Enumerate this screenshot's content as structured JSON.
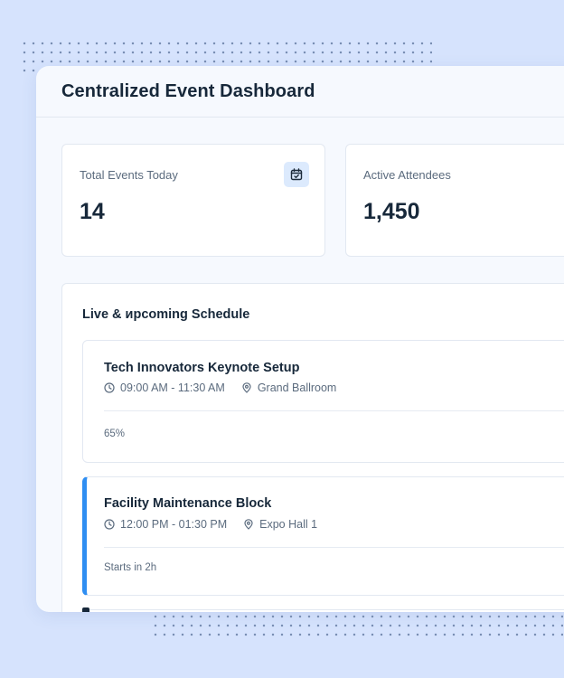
{
  "dashboard": {
    "title": "Centralized Event Dashboard"
  },
  "stats": [
    {
      "label": "Total Events Today",
      "value": "14",
      "icon": "calendar-check-icon"
    },
    {
      "label": "Active Attendees",
      "value": "1,450"
    }
  ],
  "schedule": {
    "title": "Live & иpcoming Schedule",
    "events": [
      {
        "title": "Tech Innovators Keynote Setup",
        "time": "09:00 AM - 11:30 AM",
        "location": "Grand Ballroom",
        "footer": "65%"
      },
      {
        "title": "Facility Maintenance Block",
        "time": "12:00 PM - 01:30 PM",
        "location": "Expo Hall 1",
        "footer": "Starts in 2h",
        "accent_color": "#2f8ef2"
      }
    ]
  },
  "colors": {
    "background": "#d6e3fd",
    "panel": "#f6f9fe",
    "card": "#ffffff",
    "accent": "#2f8ef2",
    "text_primary": "#17283a",
    "text_secondary": "#5b6b7e"
  }
}
